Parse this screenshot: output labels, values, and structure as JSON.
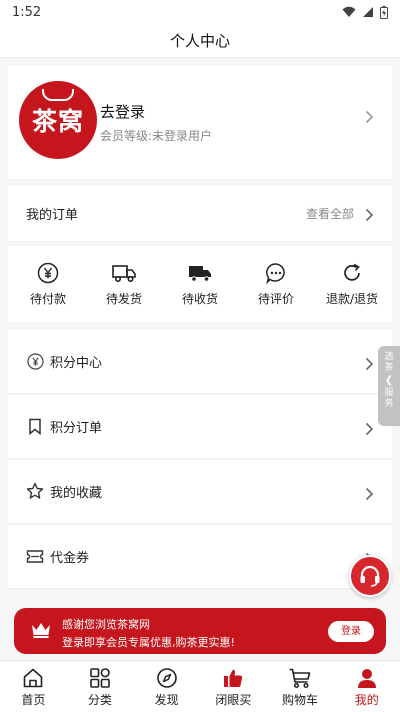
{
  "status_bar": {
    "time": "1:52"
  },
  "header": {
    "title": "个人中心"
  },
  "profile": {
    "avatar_text": "茶窝",
    "login_label": "去登录",
    "member_level": "会员等级:未登录用户"
  },
  "orders": {
    "title": "我的订单",
    "view_all": "查看全部",
    "items": [
      {
        "label": "待付款",
        "icon": "yen-icon"
      },
      {
        "label": "待发货",
        "icon": "truck-outline-icon"
      },
      {
        "label": "待收货",
        "icon": "truck-filled-icon"
      },
      {
        "label": "待评价",
        "icon": "chat-bubble-icon"
      },
      {
        "label": "退款/退货",
        "icon": "refresh-icon"
      }
    ]
  },
  "menu": [
    {
      "label": "积分中心",
      "icon": "yen-circle-icon"
    },
    {
      "label": "积分订单",
      "icon": "bookmark-icon"
    },
    {
      "label": "我的收藏",
      "icon": "star-icon"
    },
    {
      "label": "代金券",
      "icon": "coupon-icon"
    }
  ],
  "side_tab": {
    "top": "选茶",
    "bottom": "服务"
  },
  "banner": {
    "title": "感谢您浏览茶窝网",
    "subtitle": "登录即享会员专属优惠,购茶更实惠!",
    "button_label": "登录"
  },
  "tabbar": [
    {
      "label": "首页",
      "icon": "home-icon"
    },
    {
      "label": "分类",
      "icon": "grid-icon"
    },
    {
      "label": "发现",
      "icon": "compass-icon"
    },
    {
      "label": "闭眼买",
      "icon": "thumbs-up-icon"
    },
    {
      "label": "购物车",
      "icon": "cart-icon"
    },
    {
      "label": "我的",
      "icon": "user-icon"
    }
  ],
  "colors": {
    "brand": "#c4161c",
    "background": "#f6f6f6"
  }
}
